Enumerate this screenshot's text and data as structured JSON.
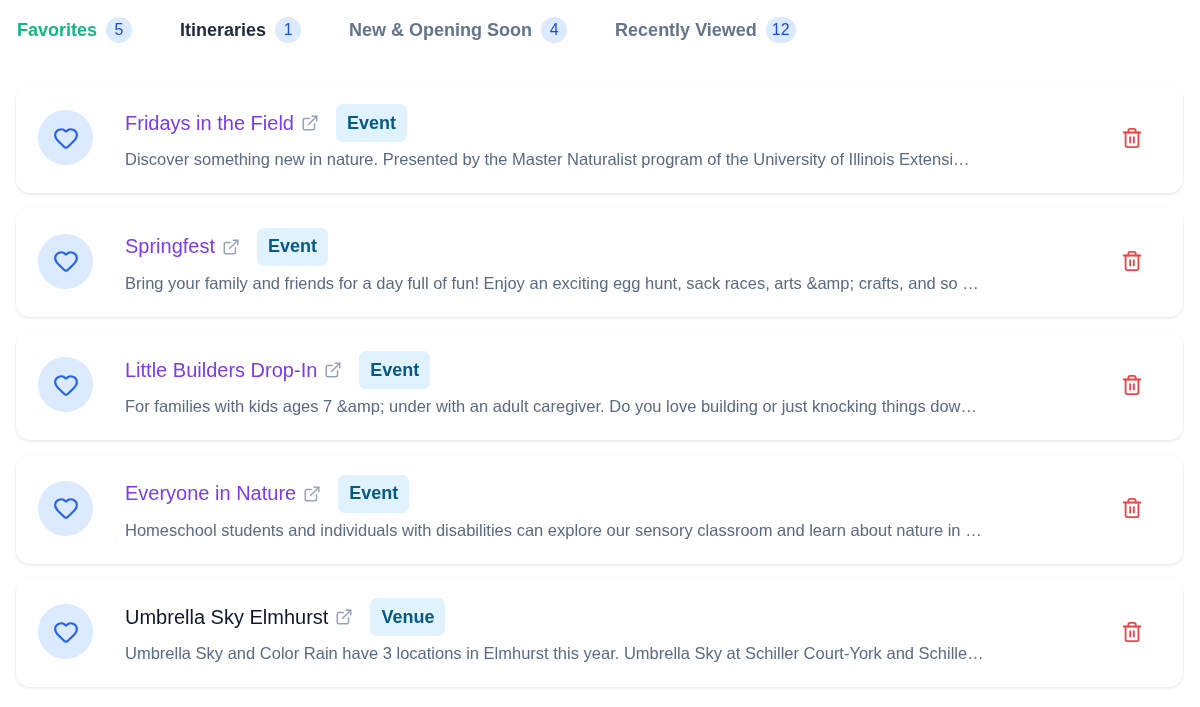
{
  "tabs": [
    {
      "label": "Favorites",
      "count": "5",
      "selected": true,
      "hovered": false
    },
    {
      "label": "Itineraries",
      "count": "1",
      "selected": false,
      "hovered": true
    },
    {
      "label": "New & Opening Soon",
      "count": "4",
      "selected": false,
      "hovered": false
    },
    {
      "label": "Recently Viewed",
      "count": "12",
      "selected": false,
      "hovered": false
    }
  ],
  "favorites": [
    {
      "title": "Fridays in the Field",
      "visited": true,
      "type": "Event",
      "description": "Discover something new in nature. Presented by the Master Naturalist program of the University of Illinois Extensi…"
    },
    {
      "title": "Springfest",
      "visited": true,
      "type": "Event",
      "description": "Bring your family and friends for a day full of fun! Enjoy an exciting egg hunt, sack races, arts &amp; crafts, and so …"
    },
    {
      "title": "Little Builders Drop-In",
      "visited": true,
      "type": "Event",
      "description": "For families with kids ages 7 &amp; under with an adult caregiver. Do you love building or just knocking things dow…"
    },
    {
      "title": "Everyone in Nature",
      "visited": true,
      "type": "Event",
      "description": "Homeschool students and individuals with disabilities can explore our sensory classroom and learn about nature in …"
    },
    {
      "title": "Umbrella Sky Elmhurst",
      "visited": false,
      "type": "Venue",
      "description": "Umbrella Sky and Color Rain have 3 locations in Elmhurst this year.  Umbrella Sky at Schiller Court-York and Schille…"
    }
  ]
}
